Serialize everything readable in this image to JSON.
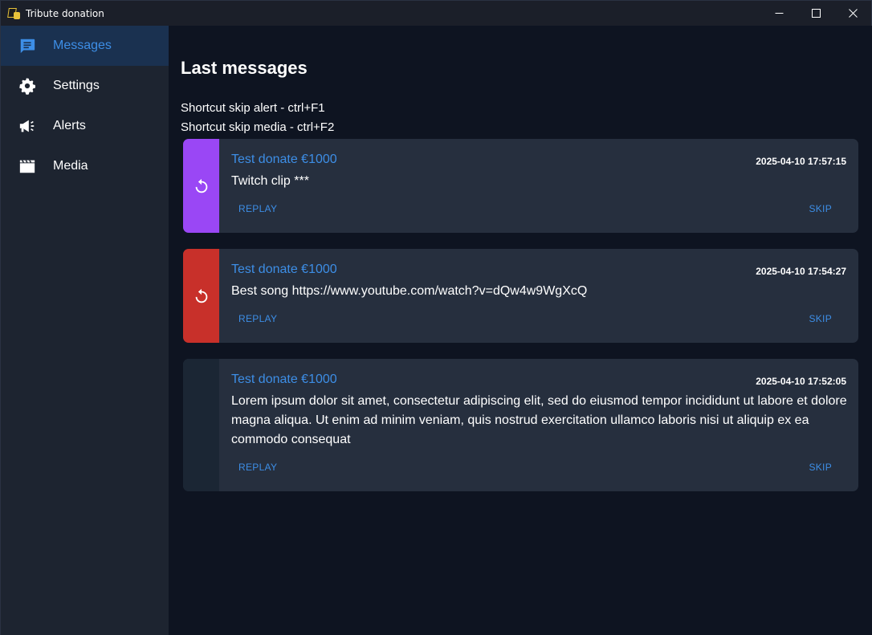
{
  "window": {
    "title": "Tribute donation"
  },
  "sidebar": {
    "items": [
      {
        "label": "Messages",
        "icon": "message-icon",
        "active": true
      },
      {
        "label": "Settings",
        "icon": "gear-icon",
        "active": false
      },
      {
        "label": "Alerts",
        "icon": "megaphone-icon",
        "active": false
      },
      {
        "label": "Media",
        "icon": "clapperboard-icon",
        "active": false
      }
    ]
  },
  "main": {
    "title": "Last messages",
    "shortcuts": [
      "Shortcut skip alert - ctrl+F1",
      "Shortcut skip media - ctrl+F2"
    ],
    "messages": [
      {
        "title": "Test donate €1000",
        "time": "2025-04-10 17:57:15",
        "body": "Twitch clip ***",
        "replay_label": "REPLAY",
        "skip_label": "SKIP",
        "stripe_color": "#9a47f5",
        "stripe_icon": "replay-icon"
      },
      {
        "title": "Test donate €1000",
        "time": "2025-04-10 17:54:27",
        "body": "Best song https://www.youtube.com/watch?v=dQw4w9WgXcQ",
        "replay_label": "REPLAY",
        "skip_label": "SKIP",
        "stripe_color": "#c8302a",
        "stripe_icon": "replay-icon"
      },
      {
        "title": "Test donate €1000",
        "time": "2025-04-10 17:52:05",
        "body": "Lorem ipsum dolor sit amet, consectetur adipiscing elit, sed do eiusmod tempor incididunt ut labore et dolore magna aliqua. Ut enim ad minim veniam, quis nostrud exercitation ullamco laboris nisi ut aliquip ex ea commodo consequat",
        "replay_label": "REPLAY",
        "skip_label": "SKIP",
        "stripe_color": "#1b2634",
        "stripe_icon": ""
      }
    ]
  },
  "colors": {
    "accent": "#3d8ee6",
    "sidebar_bg": "#1d2430",
    "main_bg": "#0e1421",
    "card_bg": "#262f3e"
  }
}
